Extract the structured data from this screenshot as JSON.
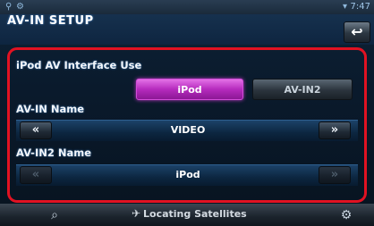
{
  "status_bar": {
    "left_icons": [
      "antenna-icon",
      "settings-small-icon"
    ],
    "right_icons": [
      "signal-icon"
    ],
    "clock": "7:47"
  },
  "header": {
    "title": "AV-IN SETUP",
    "back_icon": "back-arrow-icon"
  },
  "ipod_av_interface": {
    "label": "iPod AV Interface Use",
    "options": [
      "iPod",
      "AV-IN2"
    ],
    "selected": "iPod",
    "selected_color": "#b52bbd"
  },
  "av_in_name": {
    "label": "AV-IN Name",
    "value": "VIDEO",
    "prev_label": "«",
    "next_label": "»"
  },
  "av_in2_name": {
    "label": "AV-IN2 Name",
    "value": "iPod",
    "prev_label": "«",
    "next_label": "»",
    "enabled": false
  },
  "bottom_bar": {
    "left_icon": "search-vehicle-icon",
    "status_icon": "satellite-icon",
    "status_text": "Locating Satellites",
    "right_icon": "gear-icon"
  },
  "colors": {
    "highlight_frame": "#e11222",
    "accent": "#b52bbd"
  }
}
